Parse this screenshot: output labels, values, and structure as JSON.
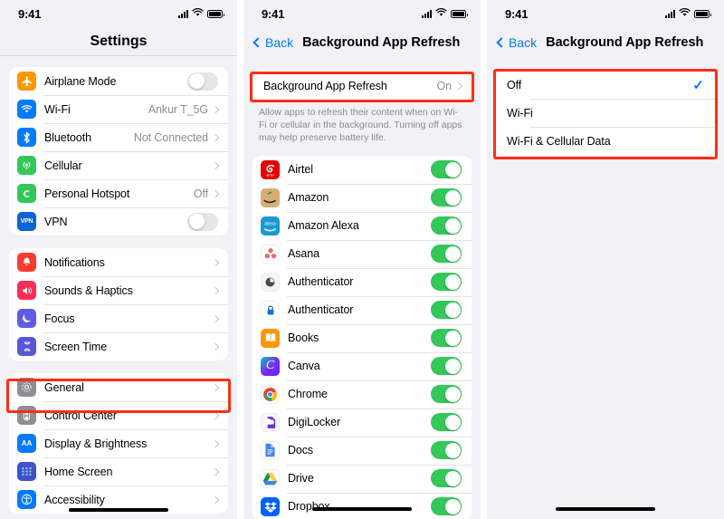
{
  "statusbar": {
    "time": "9:41",
    "signal_icon": "cellular-signal-icon",
    "wifi_icon": "wifi-icon",
    "battery_icon": "battery-icon"
  },
  "panel_settings": {
    "title": "Settings",
    "groups": [
      {
        "rows": [
          {
            "label": "Airplane Mode",
            "icon": "airplane-icon",
            "icon_bg": "#ff9500",
            "control": "toggle",
            "toggle_on": false
          },
          {
            "label": "Wi-Fi",
            "icon": "wifi-icon",
            "icon_bg": "#007aff",
            "control": "value-chevron",
            "value": "Ankur T_5G"
          },
          {
            "label": "Bluetooth",
            "icon": "bluetooth-icon",
            "icon_bg": "#007aff",
            "control": "value-chevron",
            "value": "Not Connected"
          },
          {
            "label": "Cellular",
            "icon": "cellular-icon",
            "icon_bg": "#34c759",
            "control": "chevron",
            "value": ""
          },
          {
            "label": "Personal Hotspot",
            "icon": "hotspot-icon",
            "icon_bg": "#34c759",
            "control": "value-chevron",
            "value": "Off"
          },
          {
            "label": "VPN",
            "icon": "vpn-icon",
            "icon_bg": "#0a64d6",
            "control": "toggle",
            "toggle_on": false
          }
        ]
      },
      {
        "rows": [
          {
            "label": "Notifications",
            "icon": "bell-icon",
            "icon_bg": "#ff3b30",
            "control": "chevron",
            "value": ""
          },
          {
            "label": "Sounds & Haptics",
            "icon": "speaker-icon",
            "icon_bg": "#ff2d55",
            "control": "chevron",
            "value": ""
          },
          {
            "label": "Focus",
            "icon": "moon-icon",
            "icon_bg": "#5e5ce6",
            "control": "chevron",
            "value": ""
          },
          {
            "label": "Screen Time",
            "icon": "hourglass-icon",
            "icon_bg": "#5856d6",
            "control": "chevron",
            "value": ""
          }
        ]
      },
      {
        "rows": [
          {
            "label": "General",
            "icon": "gear-icon",
            "icon_bg": "#8e8e93",
            "control": "chevron",
            "value": "",
            "highlighted": true
          },
          {
            "label": "Control Center",
            "icon": "control-center-icon",
            "icon_bg": "#8e8e93",
            "control": "chevron",
            "value": ""
          },
          {
            "label": "Display & Brightness",
            "icon": "display-brightness-icon",
            "icon_bg": "#007aff",
            "control": "chevron",
            "value": ""
          },
          {
            "label": "Home Screen",
            "icon": "home-screen-icon",
            "icon_bg": "#3e53c8",
            "control": "chevron",
            "value": ""
          },
          {
            "label": "Accessibility",
            "icon": "accessibility-icon",
            "icon_bg": "#007aff",
            "control": "chevron",
            "value": ""
          }
        ]
      }
    ]
  },
  "panel_bgr_list": {
    "back_label": "Back",
    "nav_title": "Background App Refresh",
    "master_row": {
      "label": "Background App Refresh",
      "value": "On"
    },
    "footnote": "Allow apps to refresh their content when on Wi-Fi or cellular in the background. Turning off apps may help preserve battery life.",
    "apps": [
      {
        "label": "Airtel",
        "icon": "airtel-icon",
        "toggle_on": true
      },
      {
        "label": "Amazon",
        "icon": "amazon-icon",
        "toggle_on": true
      },
      {
        "label": "Amazon Alexa",
        "icon": "amazon-alexa-icon",
        "toggle_on": true
      },
      {
        "label": "Asana",
        "icon": "asana-icon",
        "toggle_on": true
      },
      {
        "label": "Authenticator",
        "icon": "authenticator-icon",
        "toggle_on": true
      },
      {
        "label": "Authenticator",
        "icon": "authenticator-lock-icon",
        "toggle_on": true
      },
      {
        "label": "Books",
        "icon": "books-icon",
        "toggle_on": true
      },
      {
        "label": "Canva",
        "icon": "canva-icon",
        "toggle_on": true
      },
      {
        "label": "Chrome",
        "icon": "chrome-icon",
        "toggle_on": true
      },
      {
        "label": "DigiLocker",
        "icon": "digilocker-icon",
        "toggle_on": true
      },
      {
        "label": "Docs",
        "icon": "google-docs-icon",
        "toggle_on": true
      },
      {
        "label": "Drive",
        "icon": "google-drive-icon",
        "toggle_on": true
      },
      {
        "label": "Dropbox",
        "icon": "dropbox-icon",
        "toggle_on": true
      }
    ]
  },
  "panel_bgr_options": {
    "back_label": "Back",
    "nav_title": "Background App Refresh",
    "options": [
      {
        "label": "Off",
        "selected": true
      },
      {
        "label": "Wi-Fi",
        "selected": false
      },
      {
        "label": "Wi-Fi & Cellular Data",
        "selected": false
      }
    ]
  },
  "colors": {
    "accent": "#007aff",
    "toggle_on": "#34c759",
    "highlight": "#ff2d16",
    "page_bg": "#f2f1f6"
  }
}
